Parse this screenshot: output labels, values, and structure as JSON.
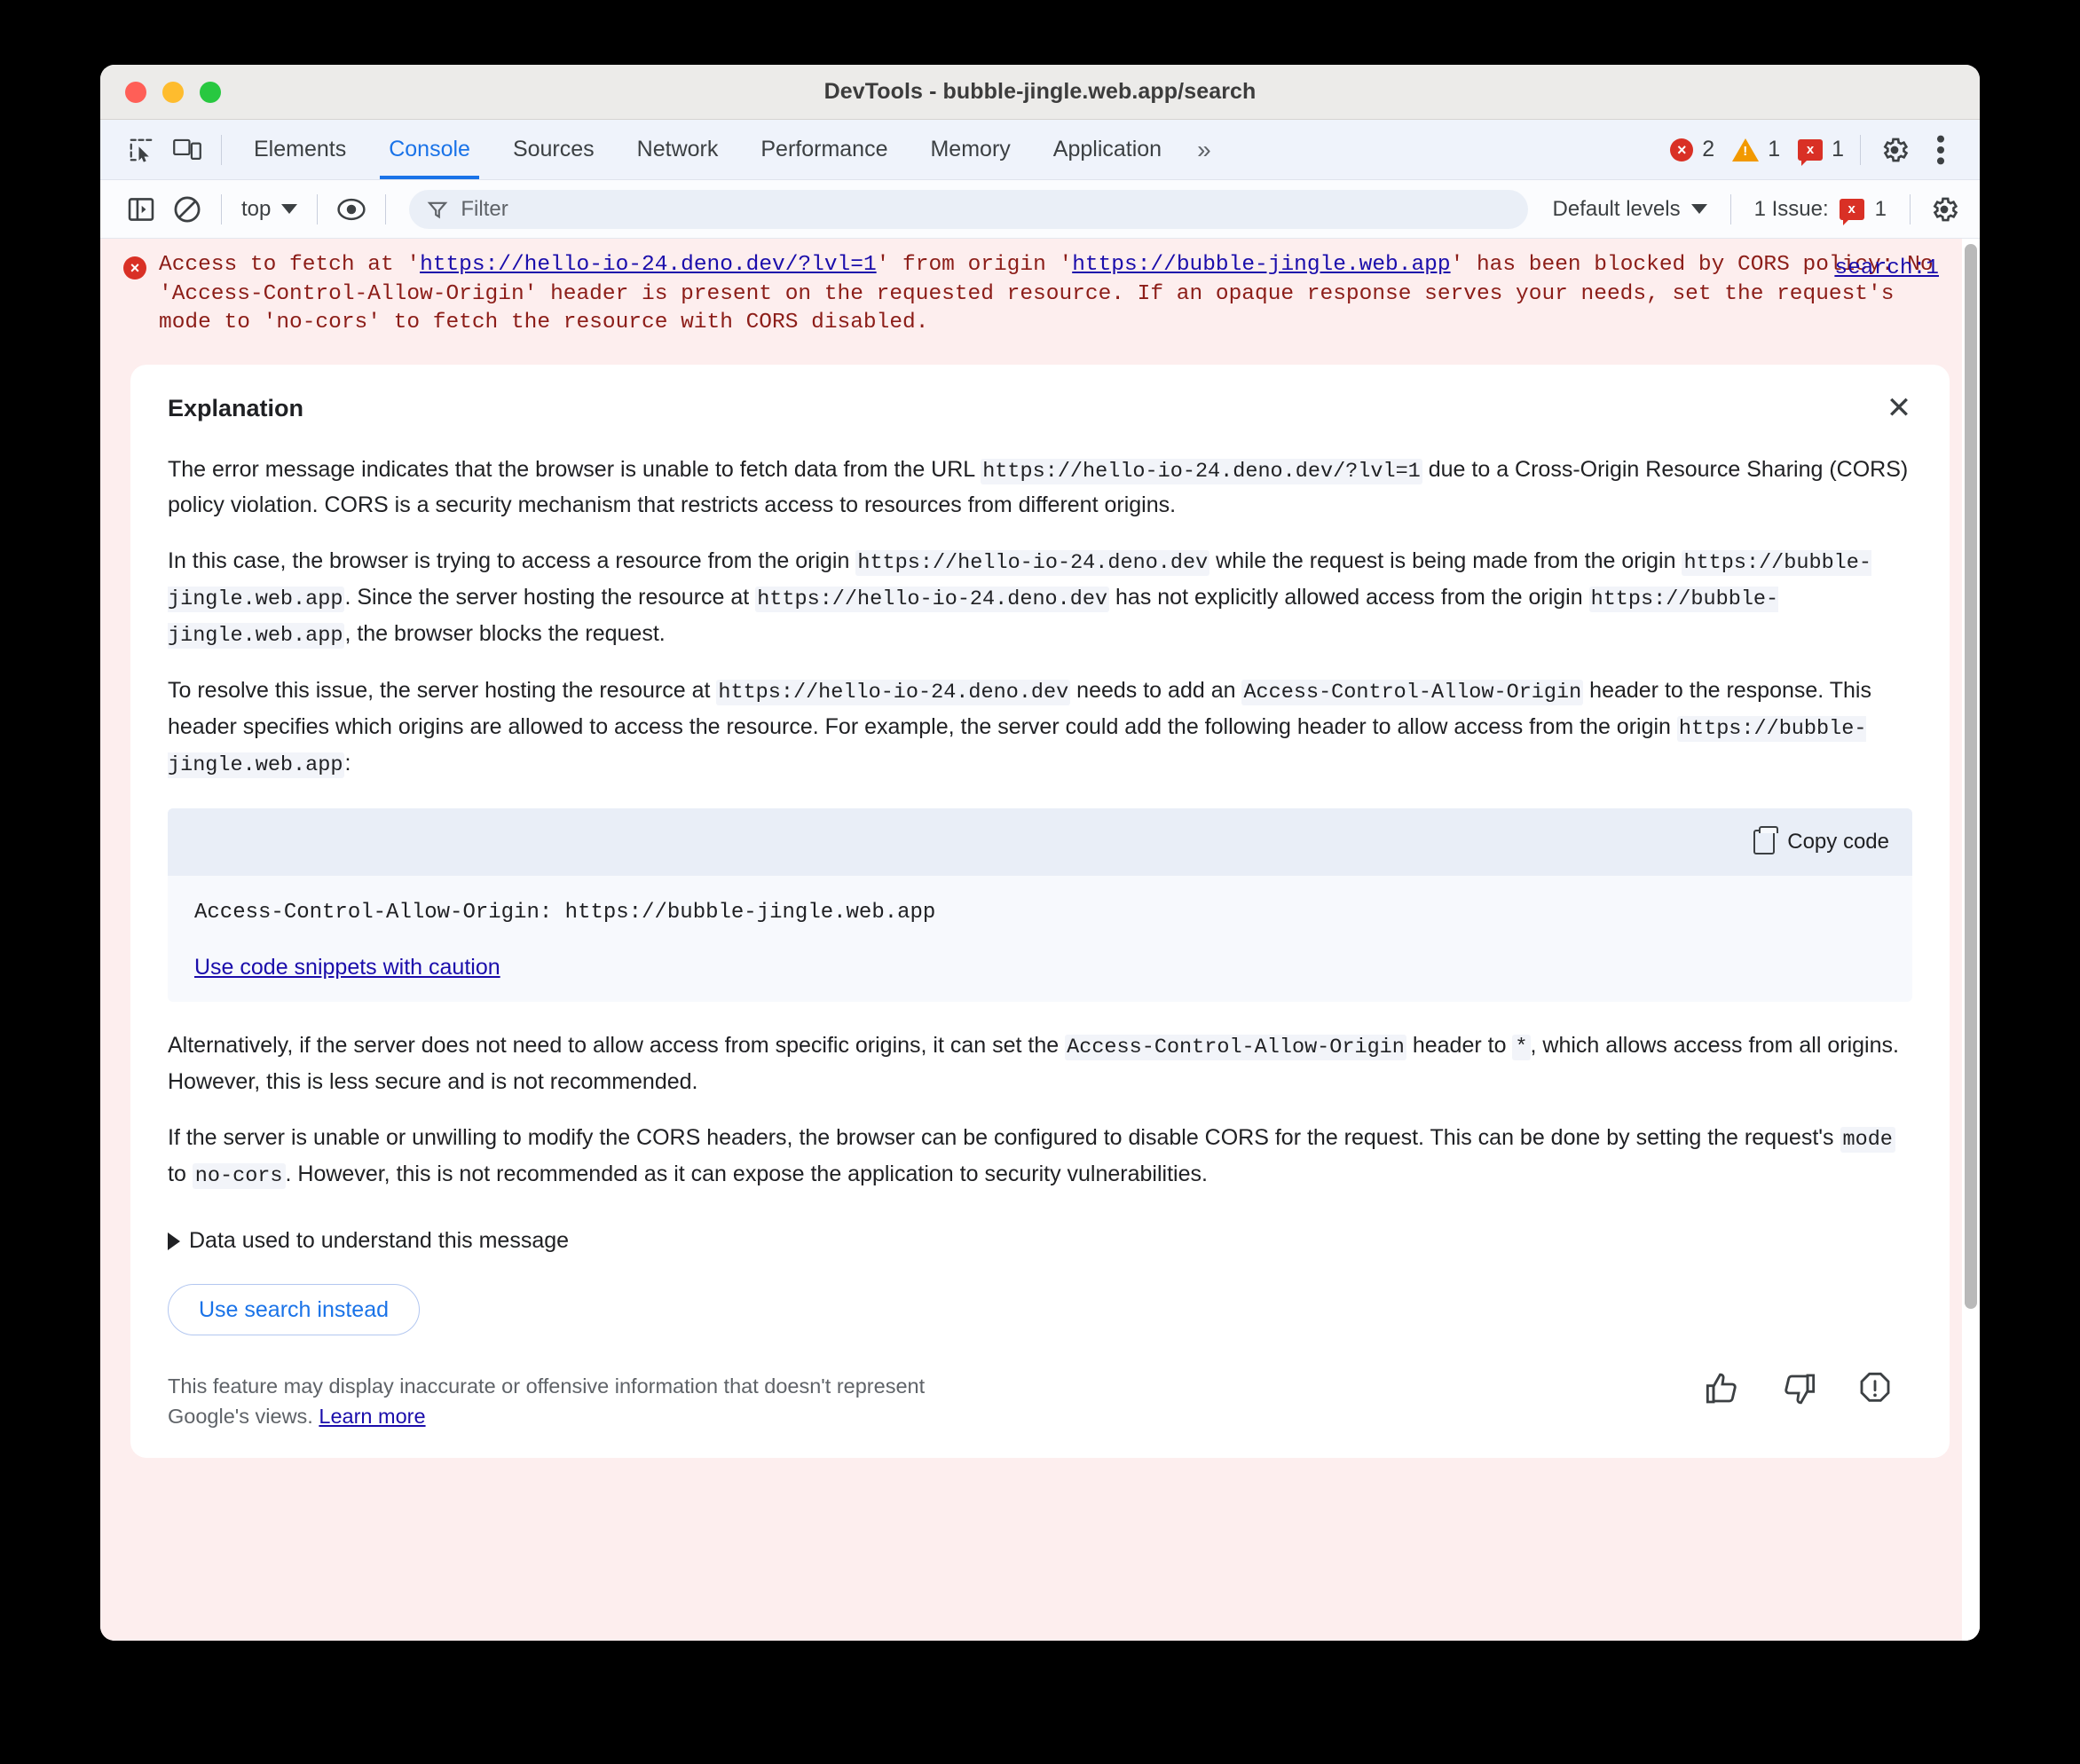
{
  "window": {
    "title": "DevTools - bubble-jingle.web.app/search",
    "traffic_lights": [
      "close",
      "minimize",
      "zoom"
    ]
  },
  "tabbar": {
    "inspect_icon": "inspect-element-icon",
    "device_icon": "device-toolbar-icon",
    "tabs": [
      {
        "label": "Elements",
        "active": false
      },
      {
        "label": "Console",
        "active": true
      },
      {
        "label": "Sources",
        "active": false
      },
      {
        "label": "Network",
        "active": false
      },
      {
        "label": "Performance",
        "active": false
      },
      {
        "label": "Memory",
        "active": false
      },
      {
        "label": "Application",
        "active": false
      }
    ],
    "more_tabs": "»",
    "counters": {
      "errors": "2",
      "warnings": "1",
      "issues": "1",
      "error_glyph": "×",
      "warning_glyph": "!",
      "issue_glyph": "x"
    },
    "settings_icon": "gear-icon",
    "more_icon": "kebab-menu-icon"
  },
  "console_toolbar": {
    "sidebar_toggle_icon": "show-console-sidebar-icon",
    "clear_icon": "clear-console-icon",
    "context": "top",
    "eye_icon": "live-expression-icon",
    "filter": {
      "placeholder": "Filter",
      "value": "",
      "icon": "filter-funnel-icon"
    },
    "levels": "Default levels",
    "issues_label": "1 Issue:",
    "issues_count": "1",
    "settings_icon": "console-settings-gear-icon"
  },
  "console_message": {
    "error_icon": "error-circle-icon",
    "prefix": "Access to fetch at '",
    "url": "https://hello-io-24.deno.dev/?lvl=1",
    "mid": "' from origin '",
    "origin": "https://bubble-jingle.web.app",
    "suffix": "' has been blocked by CORS policy: No 'Access-Control-Allow-Origin' header is present on the requested resource. If an opaque response serves your needs, set the request's mode to 'no-cors' to fetch the resource with CORS disabled.",
    "source_link": "search:1"
  },
  "explanation": {
    "title": "Explanation",
    "close_icon": "close-icon",
    "paragraph1": {
      "t1": "The error message indicates that the browser is unable to fetch data from the URL ",
      "c1": "https://hello-io-24.deno.dev/?lvl=1",
      "t2": " due to a Cross-Origin Resource Sharing (CORS) policy violation. CORS is a security mechanism that restricts access to resources from different origins."
    },
    "paragraph2": {
      "t1": "In this case, the browser is trying to access a resource from the origin ",
      "c1": "https://hello-io-24.deno.dev",
      "t2": " while the request is being made from the origin ",
      "c2": "https://bubble-jingle.web.app",
      "t3": ". Since the server hosting the resource at ",
      "c3": "https://hello-io-24.deno.dev",
      "t4": " has not explicitly allowed access from the origin ",
      "c4": "https://bubble-jingle.web.app",
      "t5": ", the browser blocks the request."
    },
    "paragraph3": {
      "t1": "To resolve this issue, the server hosting the resource at ",
      "c1": "https://hello-io-24.deno.dev",
      "t2": " needs to add an ",
      "c2": "Access-Control-Allow-Origin",
      "t3": " header to the response. This header specifies which origins are allowed to access the resource. For example, the server could add the following header to allow access from the origin ",
      "c3": "https://bubble-jingle.web.app",
      "t4": ":"
    },
    "code_block": {
      "copy_label": "Copy code",
      "copy_icon": "copy-icon",
      "code": "Access-Control-Allow-Origin: https://bubble-jingle.web.app",
      "caution_link": "Use code snippets with caution"
    },
    "paragraph4": {
      "t1": "Alternatively, if the server does not need to allow access from specific origins, it can set the ",
      "c1": "Access-Control-Allow-Origin",
      "t2": " header to ",
      "c2": "*",
      "t3": ", which allows access from all origins. However, this is less secure and is not recommended."
    },
    "paragraph5": {
      "t1": "If the server is unable or unwilling to modify the CORS headers, the browser can be configured to disable CORS for the request. This can be done by setting the request's ",
      "c1": "mode",
      "t2": " to ",
      "c2": "no-cors",
      "t3": ". However, this is not recommended as it can expose the application to security vulnerabilities."
    },
    "data_used_label": "Data used to understand this message",
    "data_used_icon": "disclosure-triangle-icon",
    "search_button": "Use search instead",
    "disclaimer": {
      "text": "This feature may display inaccurate or offensive information that doesn't represent Google's views. ",
      "link": "Learn more"
    },
    "feedback": {
      "thumbs_up_icon": "thumbs-up-icon",
      "thumbs_down_icon": "thumbs-down-icon",
      "report_icon": "report-issue-icon"
    }
  },
  "colors": {
    "accent": "#1a73e8",
    "error": "#d93025",
    "warning": "#f29900",
    "link": "#1a0dab",
    "console_error_bg": "#fdeeee"
  }
}
